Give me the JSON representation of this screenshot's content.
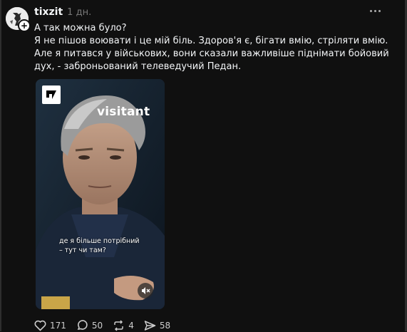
{
  "post": {
    "username": "tixzit",
    "time": "1 дн.",
    "text_line1": "А так можна було?",
    "text_line2": "Я не пішов воювати і це мій біль. Здоров'я є, бігати вмію, стріляти вмію. Але я питався у військових, вони сказали важливіше піднімати бойовий дух, - заброньований телеведучий Педан."
  },
  "video": {
    "brand": "visitant",
    "caption_line1": "де я більше потрібний",
    "caption_line2": "– тут чи там?"
  },
  "actions": {
    "likes": "171",
    "comments": "50",
    "reposts": "4",
    "shares": "58"
  },
  "icons": {
    "like": "heart-icon",
    "comment": "comment-icon",
    "repost": "repost-icon",
    "share": "send-icon",
    "mute": "mute-icon",
    "more": "more-icon"
  }
}
